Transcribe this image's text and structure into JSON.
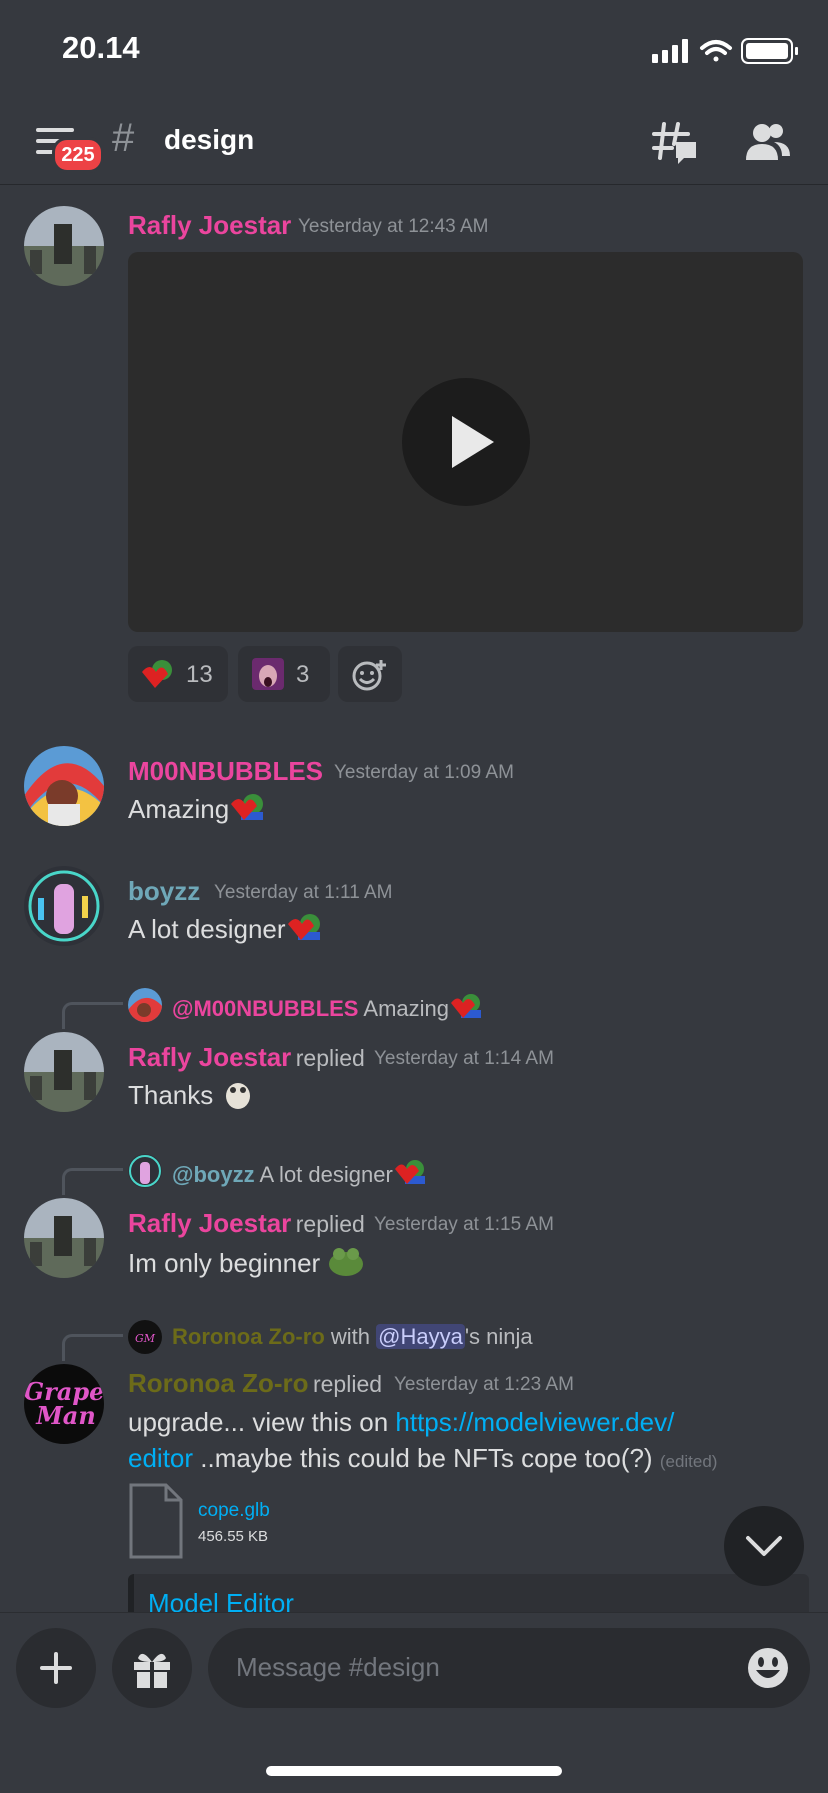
{
  "status_bar": {
    "time": "20.14"
  },
  "header": {
    "badge_count": "225",
    "hash": "#",
    "channel": "design"
  },
  "messages": [
    {
      "username": "Rafly Joestar",
      "timestamp": "Yesterday at 12:43 AM"
    },
    {
      "username": "M00NBUBBLES",
      "timestamp": "Yesterday at 1:09 AM",
      "text": "Amazing"
    },
    {
      "username": "boyzz",
      "timestamp": "Yesterday at 1:11 AM",
      "text": "A lot designer"
    },
    {
      "reply_to": "@M00NBUBBLES",
      "reply_text": "Amazing",
      "username": "Rafly Joestar",
      "replied": "replied",
      "timestamp": "Yesterday at 1:14 AM",
      "text": "Thanks"
    },
    {
      "reply_to": "@boyzz",
      "reply_text": "A lot designer",
      "username": "Rafly Joestar",
      "replied": "replied",
      "timestamp": "Yesterday at 1:15 AM",
      "text": "Im only beginner"
    },
    {
      "reply_to": "Roronoa Zo-ro",
      "reply_with": "with",
      "reply_mention": "@Hayya",
      "reply_suffix": "'s ninja",
      "username": "Roronoa Zo-ro",
      "replied": "replied",
      "timestamp": "Yesterday at 1:23 AM",
      "text_pre": "upgrade... view this on ",
      "link1": "https://modelviewer.dev/",
      "link2": "editor",
      "text_post": " ..maybe this could be NFTs cope too(?)",
      "edited": "(edited)"
    }
  ],
  "reactions": [
    {
      "count": "13"
    },
    {
      "count": "3"
    }
  ],
  "attachment": {
    "name": "cope.glb",
    "size": "456.55 KB"
  },
  "embed": {
    "title": "Model Editor"
  },
  "input": {
    "placeholder": "Message #design"
  }
}
